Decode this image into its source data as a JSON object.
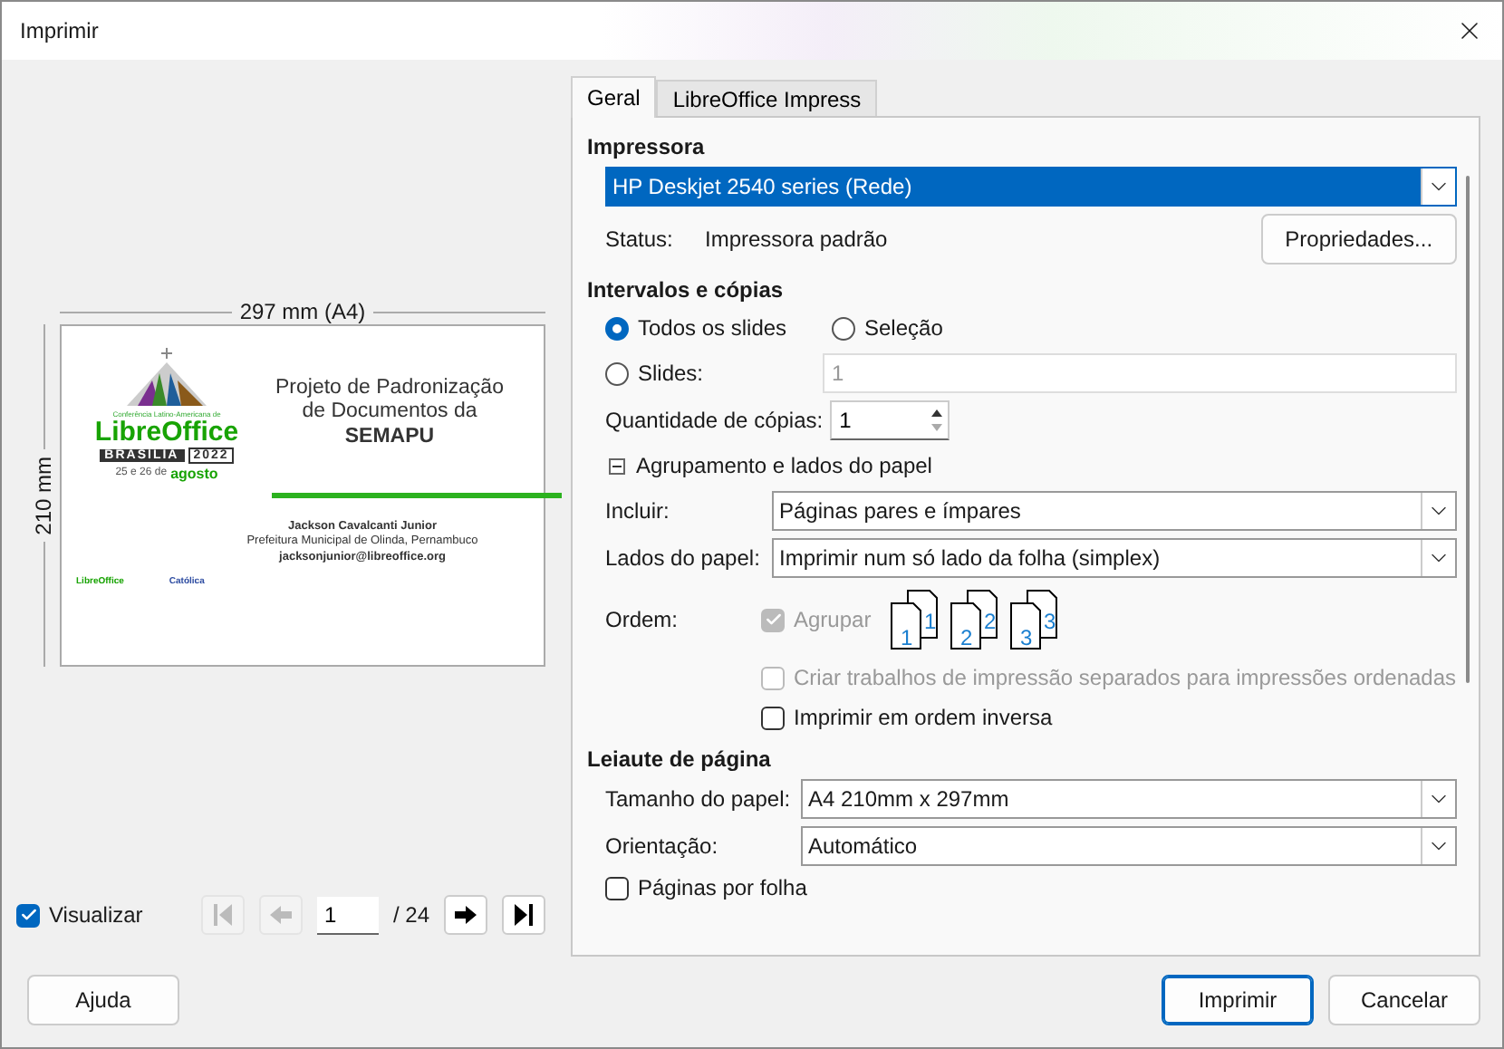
{
  "window": {
    "title": "Imprimir"
  },
  "preview": {
    "width_label": "297 mm (A4)",
    "height_label": "210 mm",
    "slide": {
      "logo_caption": "Conferência Latino-Americana de",
      "logo_name": "LibreOffice",
      "logo_city": "BRASILIA",
      "logo_year": "2022",
      "logo_date": "25 e 26 de",
      "logo_month": "agosto",
      "title": "Projeto de Padronização de Documentos da **SEMAPU**",
      "author": "Jackson Cavalcanti Junior",
      "org": "Prefeitura Municipal de Olinda, Pernambuco",
      "email": "jacksonjunior@libreoffice.org",
      "sponsors": [
        "LibreOffice",
        "Católica"
      ]
    },
    "show_preview": {
      "label": "Visualizar",
      "checked": true
    },
    "pager": {
      "page": "1",
      "total": "/ 24",
      "buttons": [
        {
          "kind": "first",
          "disabled": true
        },
        {
          "kind": "prev",
          "disabled": true
        },
        {
          "kind": "next",
          "disabled": false
        },
        {
          "kind": "last",
          "disabled": false
        }
      ]
    }
  },
  "tabs": [
    {
      "label": "Geral",
      "selected": true
    },
    {
      "label": "LibreOffice Impress",
      "selected": false
    }
  ],
  "printer": {
    "heading": "Impressora",
    "selected": "HP Deskjet 2540 series (Rede)",
    "status_label": "Status:",
    "status": "Impressora padrão",
    "properties_button": "Propriedades..."
  },
  "range": {
    "heading": "Intervalos e cópias",
    "options": [
      {
        "label": "Todos os slides",
        "selected": true
      },
      {
        "label": "Seleção",
        "selected": false
      },
      {
        "label": "Slides:",
        "selected": false
      }
    ],
    "slides_value": "1",
    "copies_label": "Quantidade de cópias:",
    "copies": "1",
    "group": {
      "label": "Agrupamento e lados do papel",
      "expanded": true
    },
    "fields": [
      {
        "label": "Incluir:",
        "value": "Páginas pares e ímpares"
      },
      {
        "label": "Lados do papel:",
        "value": "Imprimir num só lado da folha (simplex)"
      }
    ],
    "order_label": "Ordem:",
    "collate": {
      "label": "Agrupar",
      "checked": true,
      "disabled": true
    },
    "collate_pages": [
      {
        "front": "1",
        "back": "1"
      },
      {
        "front": "2",
        "back": "2"
      },
      {
        "front": "3",
        "back": "3"
      }
    ],
    "checks": [
      {
        "label": "Criar trabalhos de impressão separados para impressões ordenadas",
        "checked": false,
        "disabled": true
      },
      {
        "label": "Imprimir em ordem inversa",
        "checked": false,
        "disabled": false
      }
    ]
  },
  "layout": {
    "heading": "Leiaute de página",
    "fields": [
      {
        "label": "Tamanho do papel:",
        "value": "A4 210mm x 297mm"
      },
      {
        "label": "Orientação:",
        "value": "Automático"
      }
    ],
    "pages_per_sheet": {
      "label": "Páginas por folha",
      "checked": false
    }
  },
  "buttons": [
    {
      "label": "Ajuda",
      "primary": false
    },
    {
      "label": "Imprimir",
      "primary": true
    },
    {
      "label": "Cancelar",
      "primary": false
    }
  ]
}
